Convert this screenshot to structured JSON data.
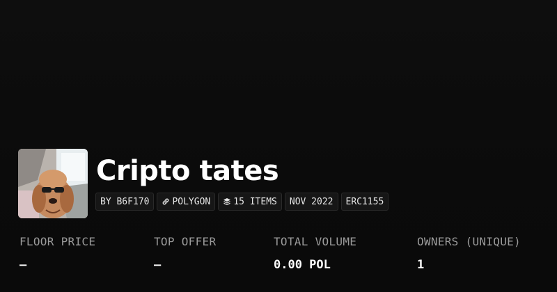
{
  "collection": {
    "title": "Cripto tates",
    "avatar_icon": "dog-with-sunglasses-photo",
    "tags": {
      "creator": "BY B6F170",
      "chain": "POLYGON",
      "chain_icon": "link-icon",
      "items": "15 ITEMS",
      "items_icon": "layers-icon",
      "date": "NOV 2022",
      "standard": "ERC1155"
    }
  },
  "stats": {
    "floor_price": {
      "label": "FLOOR PRICE",
      "value": "—"
    },
    "top_offer": {
      "label": "TOP OFFER",
      "value": "—"
    },
    "total_volume": {
      "label": "TOTAL VOLUME",
      "value": "0.00 POL"
    },
    "owners": {
      "label": "OWNERS (UNIQUE)",
      "value": "1"
    }
  },
  "colors": {
    "background": "#0a0a0a",
    "text": "#ffffff",
    "muted": "#9b9b9b",
    "tag_bg": "#161616",
    "tag_border": "#2a2a2a"
  }
}
